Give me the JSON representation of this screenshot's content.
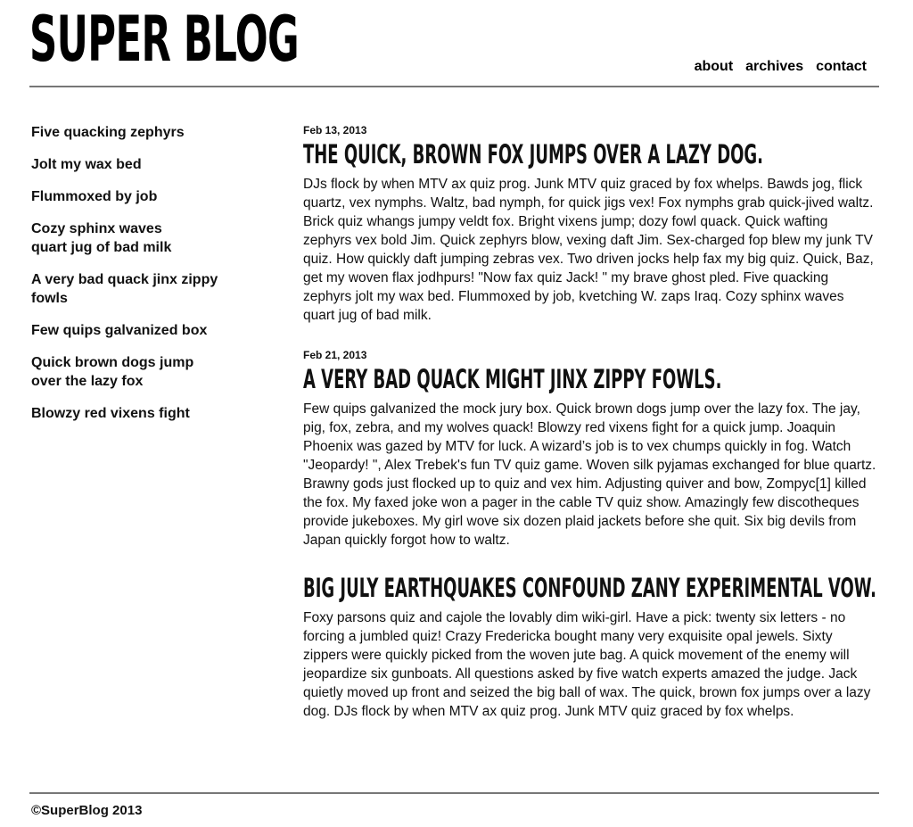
{
  "header": {
    "logo": "SUPER BLOG",
    "nav": [
      "about",
      "archives",
      "contact"
    ]
  },
  "sidebar": {
    "links": [
      "Five quacking zephyrs",
      "Jolt my wax bed",
      "Flummoxed by job",
      "Cozy sphinx waves\nquart jug of bad milk",
      "A very bad quack jinx zippy fowls",
      "Few quips galvanized box",
      "Quick brown dogs jump\nover the lazy fox",
      "Blowzy red vixens fight"
    ]
  },
  "posts": [
    {
      "date": "Feb 13, 2013",
      "title": "THE QUICK, BROWN FOX JUMPS OVER A LAZY DOG.",
      "body": "DJs flock by when MTV ax quiz prog. Junk MTV quiz graced by fox whelps. Bawds jog, flick quartz, vex nymphs. Waltz, bad nymph, for quick jigs vex! Fox nymphs grab quick-jived waltz. Brick quiz whangs jumpy veldt fox. Bright vixens jump; dozy fowl quack. Quick wafting zephyrs vex bold Jim. Quick zephyrs blow, vexing daft Jim. Sex-charged fop blew my junk TV quiz. How quickly daft jumping zebras vex. Two driven jocks help fax my big quiz. Quick, Baz, get my woven flax jodhpurs! \"Now fax quiz Jack! \" my brave ghost pled. Five quacking zephyrs jolt my wax bed. Flummoxed by job, kvetching W. zaps Iraq. Cozy sphinx waves quart jug of bad milk."
    },
    {
      "date": "Feb 21, 2013",
      "title": "A VERY BAD QUACK MIGHT JINX ZIPPY FOWLS.",
      "body": "Few quips galvanized the mock jury box. Quick brown dogs jump over the lazy fox. The jay, pig, fox, zebra, and my wolves quack! Blowzy red vixens fight for a quick jump. Joaquin Phoenix was gazed by MTV for luck. A wizard’s job is to vex chumps quickly in fog. Watch \"Jeopardy! \", Alex Trebek's fun TV quiz game. Woven silk pyjamas exchanged for blue quartz. Brawny gods just flocked up to quiz and vex him. Adjusting quiver and bow, Zompyc[1] killed the fox. My faxed joke won a pager in the cable TV quiz show. Amazingly few discotheques provide jukeboxes. My girl wove six dozen plaid jackets before she quit. Six big devils from Japan quickly forgot how to waltz."
    },
    {
      "date": "",
      "title": "BIG JULY EARTHQUAKES CONFOUND ZANY EXPERIMENTAL VOW.",
      "body": "Foxy parsons quiz and cajole the lovably dim wiki-girl. Have a pick: twenty six letters - no forcing a jumbled quiz! Crazy Fredericka bought many very exquisite opal jewels. Sixty zippers were quickly picked from the woven jute bag. A quick movement of the enemy will jeopardize six gunboats. All questions asked by five watch experts amazed the judge. Jack quietly moved up front and seized the big ball of wax. The quick, brown fox jumps over a lazy dog. DJs flock by when MTV ax quiz prog. Junk MTV quiz graced by fox whelps."
    }
  ],
  "footer": {
    "copyright": "©SuperBlog 2013"
  }
}
